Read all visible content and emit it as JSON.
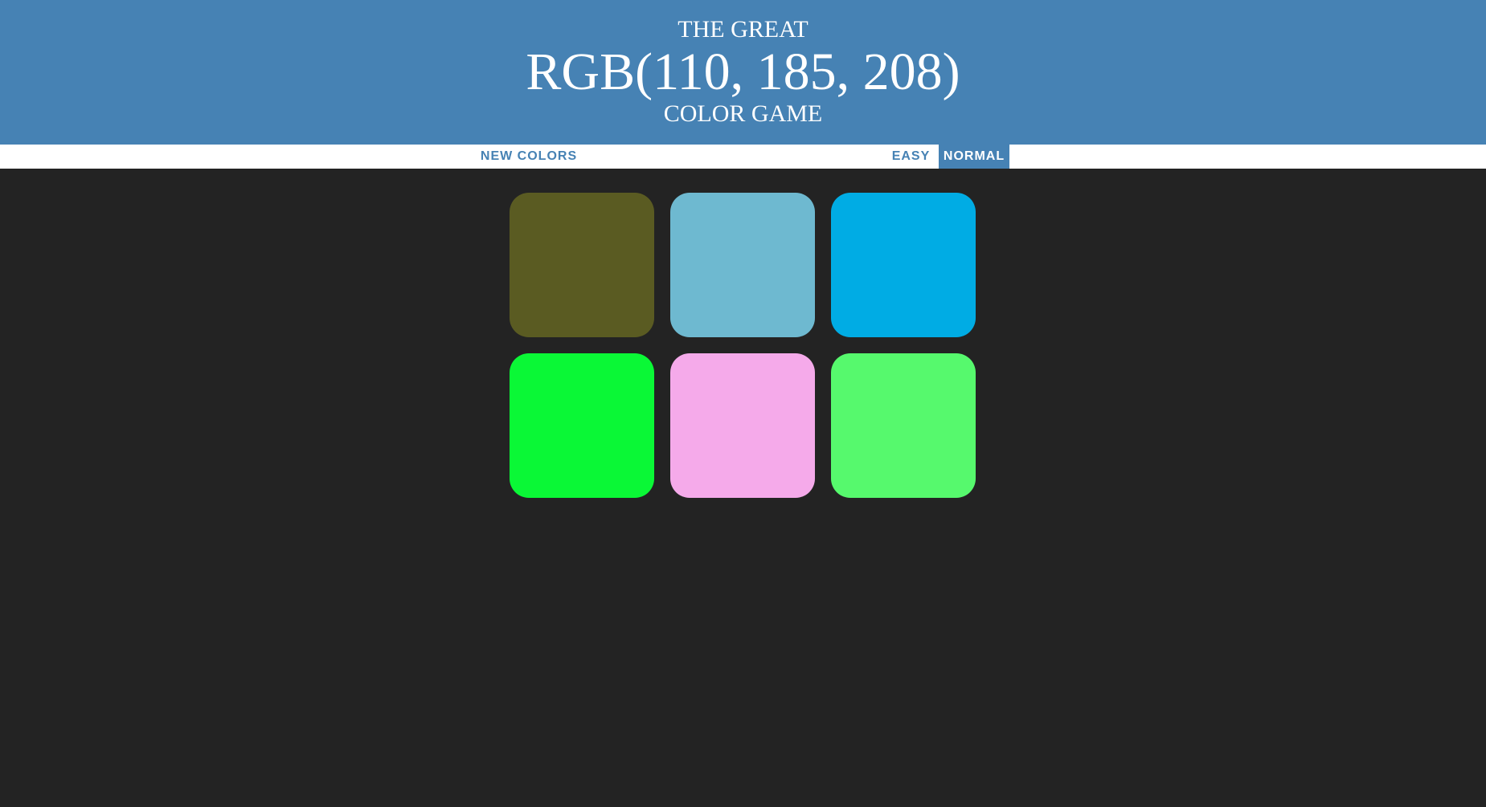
{
  "header": {
    "line_top": "THE GREAT",
    "rgb_display": "RGB(110, 185, 208)",
    "line_bottom": "COLOR GAME",
    "background": "#4682b4"
  },
  "stripe": {
    "new_colors_label": "NEW COLORS",
    "easy_label": "EASY",
    "normal_label": "NORMAL",
    "selected_mode": "NORMAL",
    "accent": "#4682b4"
  },
  "body_background": "#232323",
  "squares": [
    {
      "color": "#5a5b22"
    },
    {
      "color": "#6eb9d0"
    },
    {
      "color": "#00ace4"
    },
    {
      "color": "#0af836"
    },
    {
      "color": "#f5aaea"
    },
    {
      "color": "#56f96d"
    }
  ]
}
